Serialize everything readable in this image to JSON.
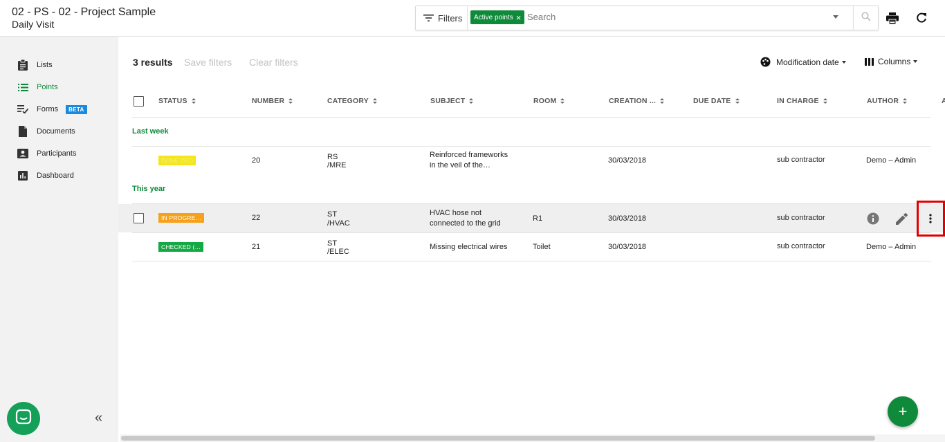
{
  "header": {
    "project_title": "02 - PS - 02 - Project Sample",
    "project_subtitle": "Daily Visit",
    "filters_label": "Filters",
    "active_chip": "Active points",
    "search_placeholder": "Search",
    "icons": [
      "filter-icon",
      "close-icon",
      "chevron-down-icon",
      "search-icon",
      "print-icon",
      "refresh-icon"
    ]
  },
  "sidebar": {
    "items": [
      {
        "label": "Lists",
        "icon": "clipboard-icon"
      },
      {
        "label": "Points",
        "icon": "list-icon",
        "active": true
      },
      {
        "label": "Forms",
        "icon": "checklist-icon",
        "badge": "BETA"
      },
      {
        "label": "Documents",
        "icon": "document-icon"
      },
      {
        "label": "Participants",
        "icon": "contact-icon"
      },
      {
        "label": "Dashboard",
        "icon": "chart-icon"
      }
    ],
    "collapse_glyph": "«"
  },
  "toolbar": {
    "results": "3 results",
    "save_filters": "Save filters",
    "clear_filters": "Clear filters",
    "sort_label": "Modification date",
    "columns_label": "Columns"
  },
  "table": {
    "columns": [
      "STATUS",
      "NUMBER",
      "CATEGORY",
      "SUBJECT",
      "ROOM",
      "CREATION ...",
      "DUE DATE",
      "IN CHARGE",
      "AUTHOR",
      "A"
    ],
    "groups": [
      {
        "label": "Last week",
        "rows": [
          {
            "status": "DONE (SC)",
            "status_color": "#f5e51a",
            "status_text_color": "#e6e6a0",
            "number": "20",
            "category_1": "RS",
            "category_2": "/MRE",
            "subject_1": "Reinforced frameworks",
            "subject_2": "in the veil of the…",
            "room": "",
            "creation": "30/03/2018",
            "due": "",
            "in_charge": "sub contractor",
            "author": "Demo – Admin"
          }
        ]
      },
      {
        "label": "This year",
        "rows": [
          {
            "status": "IN PROGRE…",
            "status_color": "#f5a21a",
            "status_text_color": "#ffffff",
            "number": "22",
            "category_1": "ST",
            "category_2": "/HVAC",
            "subject_1": "HVAC hose not",
            "subject_2": "connected to the grid",
            "room": "R1",
            "creation": "30/03/2018",
            "due": "",
            "in_charge": "sub contractor",
            "author": ""
          },
          {
            "status": "CHECKED (…",
            "status_color": "#15a844",
            "status_text_color": "#ffffff",
            "number": "21",
            "category_1": "ST",
            "category_2": "/ELEC",
            "subject_1": "Missing electrical wires",
            "subject_2": "",
            "room": "Toilet",
            "creation": "30/03/2018",
            "due": "",
            "in_charge": "sub contractor",
            "author": "Demo – Admin"
          }
        ]
      }
    ],
    "row_actions": [
      "info-icon",
      "edit-icon",
      "more-vert-icon"
    ]
  },
  "fab": {
    "label": "+"
  },
  "colors": {
    "accent": "#0e8a3a",
    "highlight_box": "#e10000",
    "beta": "#1a8ae0"
  }
}
